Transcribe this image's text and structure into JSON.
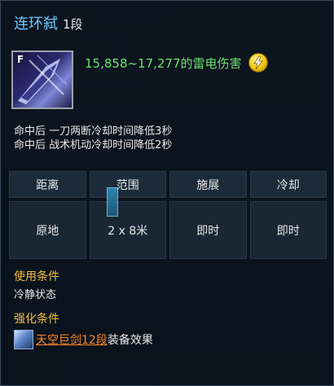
{
  "tooltip": {
    "title": "连环弑",
    "grade": "1段",
    "icon_key": "F",
    "damage": "15,858~17,277的雷电伤害",
    "damage_icon": "lightning-icon",
    "effects": [
      "命中后 一刀两断冷却时间降低3秒",
      "命中后 战术机动冷却时间降低2秒"
    ],
    "stats": {
      "headers": [
        "距离",
        "范围",
        "施展",
        "冷却"
      ],
      "values": [
        "原地",
        "2 x 8米",
        "即时",
        "即时"
      ]
    },
    "use_condition": {
      "label": "使用条件",
      "value": "冷静状态"
    },
    "enhance_condition": {
      "label": "强化条件",
      "set_link": "天空巨剑12段",
      "suffix": "装备效果"
    }
  },
  "colors": {
    "title": "#6ec8ff",
    "damage": "#6fe06f",
    "section_label": "#f0c040",
    "set_link": "#ff8a2a"
  }
}
